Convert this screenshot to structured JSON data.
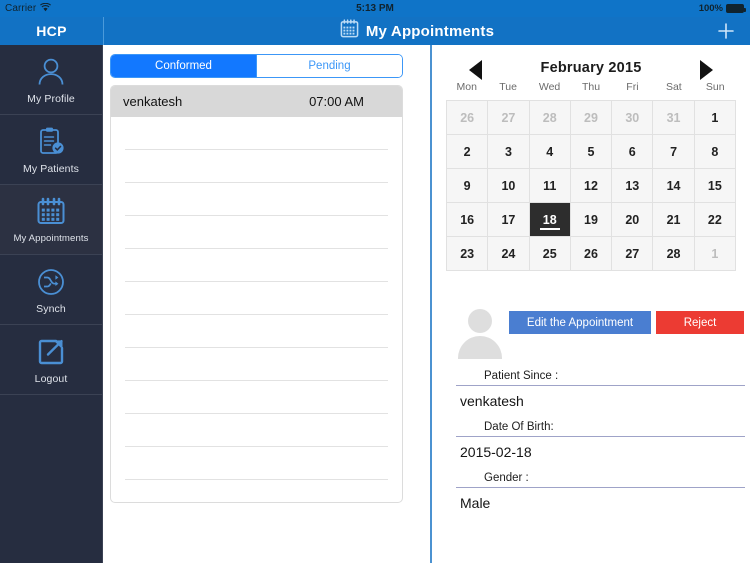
{
  "statusbar": {
    "carrier": "Carrier",
    "wifi_icon": "wifi-icon",
    "time": "5:13 PM",
    "battery_percent": "100%",
    "battery_icon": "battery-full-icon"
  },
  "navbar": {
    "brand": "HCP",
    "title": "My Appointments",
    "title_icon": "calendar-icon",
    "add_icon": "plus-icon",
    "background": "#1272c4"
  },
  "sidebar": {
    "background": "#262d40",
    "icon_color": "#4a8fd4",
    "items": [
      {
        "label": "My Profile",
        "icon": "user-icon",
        "selected": false
      },
      {
        "label": "My Patients",
        "icon": "clipboard-check-icon",
        "selected": false
      },
      {
        "label": "My Appointments",
        "icon": "calendar-icon",
        "selected": true
      },
      {
        "label": "Synch",
        "icon": "sync-icon",
        "selected": false
      },
      {
        "label": "Logout",
        "icon": "logout-icon",
        "selected": false
      }
    ]
  },
  "list_panel": {
    "tabs": [
      {
        "label": "Conformed",
        "active": true
      },
      {
        "label": "Pending",
        "active": false
      }
    ],
    "accent": "#1278ff",
    "appointments": [
      {
        "name": "venkatesh",
        "time": "07:00 AM"
      }
    ],
    "empty_rows": 11
  },
  "calendar": {
    "prev_icon": "arrow-left-icon",
    "next_icon": "arrow-right-icon",
    "title": "February 2015",
    "weekdays": [
      "Mon",
      "Tue",
      "Wed",
      "Thu",
      "Fri",
      "Sat",
      "Sun"
    ],
    "selected_day": 18,
    "weeks": [
      [
        {
          "d": "26",
          "muted": true
        },
        {
          "d": "27",
          "muted": true
        },
        {
          "d": "28",
          "muted": true
        },
        {
          "d": "29",
          "muted": true
        },
        {
          "d": "30",
          "muted": true
        },
        {
          "d": "31",
          "muted": true
        },
        {
          "d": "1",
          "muted": false
        }
      ],
      [
        {
          "d": "2",
          "muted": false
        },
        {
          "d": "3",
          "muted": false
        },
        {
          "d": "4",
          "muted": false
        },
        {
          "d": "5",
          "muted": false
        },
        {
          "d": "6",
          "muted": false
        },
        {
          "d": "7",
          "muted": false
        },
        {
          "d": "8",
          "muted": false
        }
      ],
      [
        {
          "d": "9",
          "muted": false
        },
        {
          "d": "10",
          "muted": false
        },
        {
          "d": "11",
          "muted": false
        },
        {
          "d": "12",
          "muted": false
        },
        {
          "d": "13",
          "muted": false
        },
        {
          "d": "14",
          "muted": false
        },
        {
          "d": "15",
          "muted": false
        }
      ],
      [
        {
          "d": "16",
          "muted": false
        },
        {
          "d": "17",
          "muted": false
        },
        {
          "d": "18",
          "muted": false,
          "selected": true
        },
        {
          "d": "19",
          "muted": false
        },
        {
          "d": "20",
          "muted": false
        },
        {
          "d": "21",
          "muted": false
        },
        {
          "d": "22",
          "muted": false
        }
      ],
      [
        {
          "d": "23",
          "muted": false
        },
        {
          "d": "24",
          "muted": false
        },
        {
          "d": "25",
          "muted": false
        },
        {
          "d": "26",
          "muted": false
        },
        {
          "d": "27",
          "muted": false
        },
        {
          "d": "28",
          "muted": false
        },
        {
          "d": "1",
          "muted": true
        }
      ]
    ]
  },
  "detail": {
    "avatar_icon": "avatar-placeholder-icon",
    "buttons": {
      "edit": {
        "label": "Edit the Appointment",
        "color": "#4a7ed1"
      },
      "reject": {
        "label": "Reject",
        "color": "#ec3b33"
      }
    },
    "fields": [
      {
        "label": "Patient Since :",
        "value": "venkatesh"
      },
      {
        "label": "Date Of Birth:",
        "value": "2015-02-18"
      },
      {
        "label": "Gender :",
        "value": "Male"
      }
    ]
  }
}
